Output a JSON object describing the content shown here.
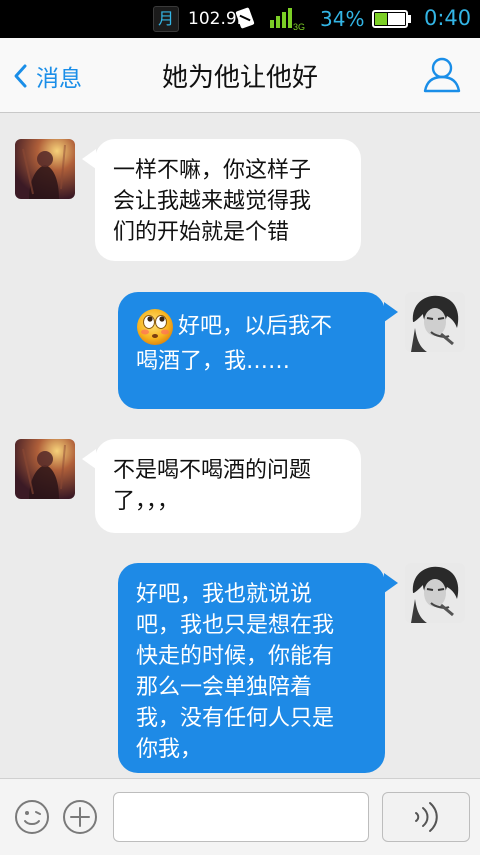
{
  "status_bar": {
    "moon_glyph": "月",
    "radio": "102.9M",
    "signal_label": "3G",
    "battery_percent": "34%",
    "time": "0:40",
    "accent_color": "#33b5e5"
  },
  "nav": {
    "back_label": "消息",
    "title": "她为他让他好",
    "back_icon": "chevron-left-icon",
    "profile_icon": "person-icon",
    "accent_color": "#1a8ee8"
  },
  "messages": [
    {
      "side": "left",
      "lines": [
        "一样不嘛，你这样子",
        "会让我越来越觉得我",
        "们的开始就是个错"
      ]
    },
    {
      "side": "right",
      "has_emoji": true,
      "emoji": "rolling-eyes-emoji",
      "lines": [
        "好吧，以后我不",
        "喝酒了，我……"
      ]
    },
    {
      "side": "left",
      "lines": [
        "不是喝不喝酒的问题",
        "了，，，"
      ]
    },
    {
      "side": "right",
      "lines": [
        "好吧，我也就说说",
        "吧，我也只是想在我",
        "快走的时候，你能有",
        "那么一会单独陪着",
        "我，没有任何人只是",
        "你我，"
      ]
    }
  ],
  "colors": {
    "chat_bg": "#ebebeb",
    "left_bubble": "#ffffff",
    "right_bubble": "#1e8ae6"
  },
  "input_bar": {
    "emoji_icon": "smiley-icon",
    "plus_icon": "plus-circle-icon",
    "voice_icon": "voice-wave-icon",
    "text_value": "",
    "placeholder": ""
  }
}
